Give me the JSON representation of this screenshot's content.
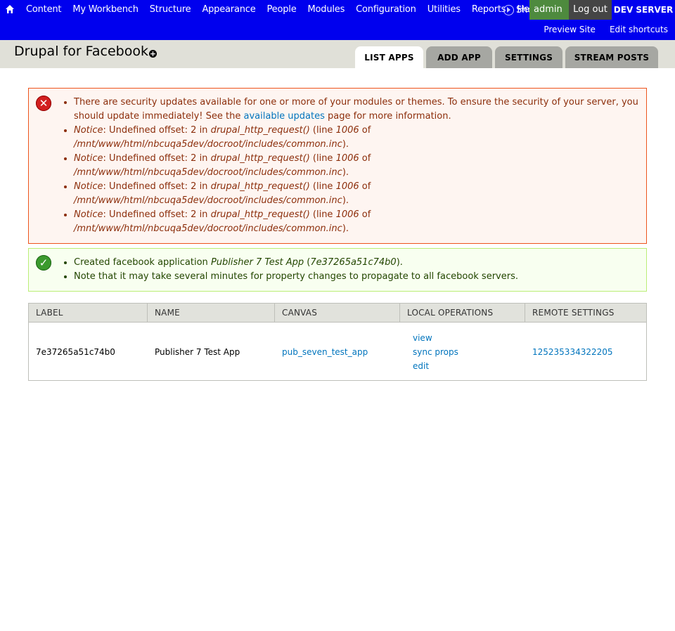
{
  "toolbar": {
    "menu": [
      "Content",
      "My Workbench",
      "Structure",
      "Appearance",
      "People",
      "Modules",
      "Configuration",
      "Utilities",
      "Reports",
      "Help"
    ],
    "shortcuts_label": "Shortcuts",
    "user_label": "admin",
    "logout_label": "Log out",
    "env_label": "DEV SERVER",
    "shortcut_links": [
      "Preview Site",
      "Edit shortcuts"
    ]
  },
  "header": {
    "title": "Drupal for Facebook",
    "tabs": [
      "LIST APPS",
      "ADD APP",
      "SETTINGS",
      "STREAM POSTS"
    ]
  },
  "errors": {
    "security_part1": "There are security updates available for one or more of your modules or themes. To ensure the security of your server, you should update immediately! See the ",
    "security_link": "available updates",
    "security_part2": " page for more information.",
    "notice_label": "Notice",
    "notice_text": ": Undefined offset: 2 in ",
    "notice_func": "drupal_http_request()",
    "notice_line_pre": " (line ",
    "notice_line": "1006",
    "notice_of": " of",
    "notice_path": "/mnt/www/html/nbcuqa5dev/docroot/includes/common.inc",
    "notice_end": ")."
  },
  "status": {
    "created_prefix": "Created facebook application ",
    "app_name": "Publisher 7 Test App",
    "paren_open": " (",
    "app_id": "7e37265a51c74b0",
    "paren_close": ").",
    "note": "Note that it may take several minutes for property changes to propagate to all facebook servers."
  },
  "table": {
    "headers": [
      "LABEL",
      "NAME",
      "CANVAS",
      "LOCAL OPERATIONS",
      "REMOTE SETTINGS"
    ],
    "row": {
      "label": "7e37265a51c74b0",
      "name": "Publisher 7 Test App",
      "canvas": "pub_seven_test_app",
      "ops": [
        "view",
        "sync props",
        "edit"
      ],
      "remote": "125235334322205"
    }
  },
  "colors": {
    "toolbar_bg": "#0000ee",
    "link": "#0074bd",
    "error_border": "#ed541d",
    "status_border": "#bbee77"
  }
}
